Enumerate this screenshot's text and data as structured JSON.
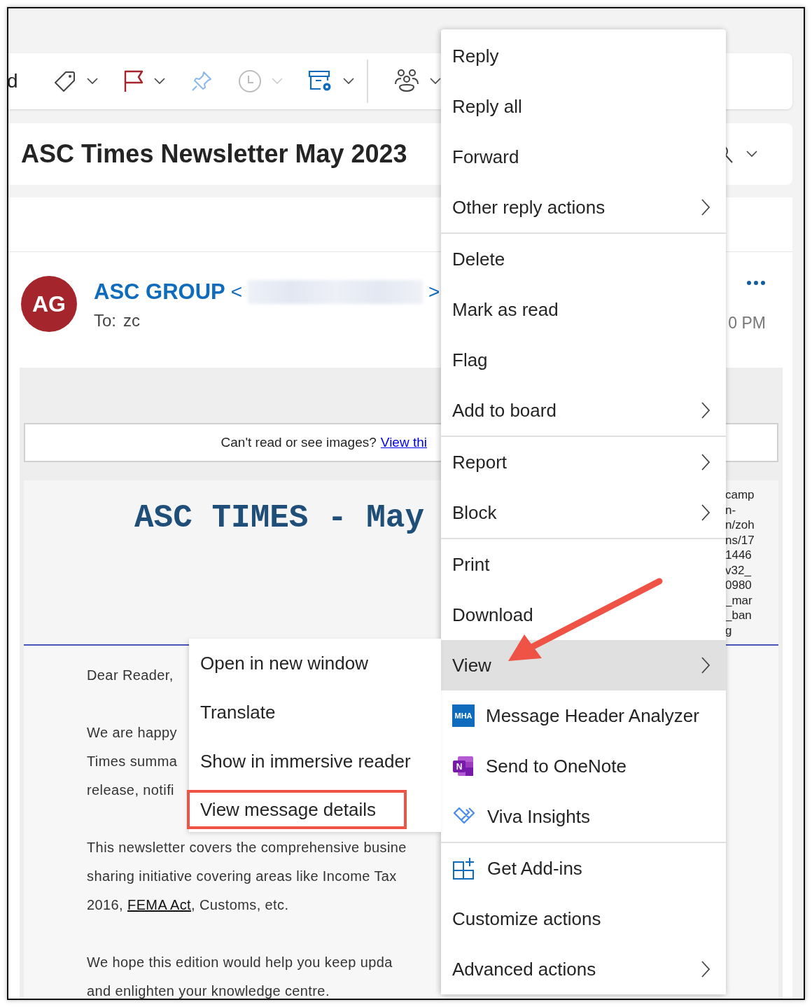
{
  "toolbar": {
    "cut_label": "d",
    "items": [
      {
        "kind": "tag",
        "dropdown": true,
        "disabled": false
      },
      {
        "kind": "flag",
        "dropdown": true,
        "disabled": false
      },
      {
        "kind": "pin",
        "dropdown": false,
        "disabled": false
      },
      {
        "kind": "snooze",
        "dropdown": true,
        "disabled": true
      },
      {
        "kind": "rules",
        "dropdown": true,
        "disabled": false
      },
      {
        "kind": "divider"
      },
      {
        "kind": "groups",
        "dropdown": true,
        "disabled": false
      }
    ]
  },
  "subject": "ASC Times Newsletter May 2023",
  "message": {
    "avatar_initials": "AG",
    "sender": "ASC GROUP",
    "open_bracket": "<",
    "close_bracket": ">",
    "to_label": "To:",
    "to": "zc",
    "time": "0 PM"
  },
  "body": {
    "notice": "Can't read or see images?",
    "notice_link": "View thi",
    "banner_title": "ASC TIMES - May",
    "banner_alt_lines": [
      "camp",
      "n-",
      "n/zoh",
      "ns/17",
      "1446",
      "v32_",
      "0980",
      "_mar",
      "_ban",
      "g"
    ],
    "paragraphs": [
      [
        {
          "text": "Dear Reader,"
        }
      ],
      [
        {
          "text": "We are happy"
        },
        {
          "text": "Times summa"
        },
        {
          "text": "release, notifi"
        }
      ],
      [
        {
          "text": "This newsletter covers the comprehensive busine"
        },
        {
          "text": "sharing initiative covering areas like Income Tax"
        },
        {
          "text": "2016, ",
          "link": "FEMA Act",
          "after": ", Customs, etc."
        }
      ],
      [
        {
          "text": "We hope this edition would help you keep upda"
        },
        {
          "text": "and enlighten your knowledge centre."
        }
      ]
    ]
  },
  "context_menu": {
    "groups": [
      [
        {
          "label": "Reply",
          "kind": "action",
          "selected": false
        },
        {
          "label": "Reply all",
          "kind": "action",
          "selected": false
        },
        {
          "label": "Forward",
          "kind": "action",
          "selected": false
        },
        {
          "label": "Other reply actions",
          "kind": "submenu",
          "selected": false
        }
      ],
      [
        {
          "label": "Delete",
          "kind": "action",
          "selected": false
        },
        {
          "label": "Mark as read",
          "kind": "action",
          "selected": false
        },
        {
          "label": "Flag",
          "kind": "action",
          "selected": false
        },
        {
          "label": "Add to board",
          "kind": "submenu",
          "selected": false
        }
      ],
      [
        {
          "label": "Report",
          "kind": "submenu",
          "selected": false
        },
        {
          "label": "Block",
          "kind": "submenu",
          "selected": false
        }
      ],
      [
        {
          "label": "Print",
          "kind": "action",
          "selected": false
        },
        {
          "label": "Download",
          "kind": "action",
          "selected": false
        },
        {
          "label": "View",
          "kind": "submenu",
          "selected": true
        },
        {
          "label": "Message Header Analyzer",
          "kind": "analyzer",
          "badge": "MHA",
          "selected": false
        },
        {
          "label": "Send to OneNote",
          "kind": "notebook",
          "badge": "N",
          "selected": false
        },
        {
          "label": "Viva Insights",
          "kind": "insights",
          "selected": false
        }
      ],
      [
        {
          "label": "Get Add-ins",
          "kind": "addins",
          "selected": false
        },
        {
          "label": "Customize actions",
          "kind": "action",
          "selected": false
        },
        {
          "label": "Advanced actions",
          "kind": "submenu",
          "selected": false
        }
      ]
    ]
  },
  "view_submenu": {
    "items": [
      {
        "label": "Open in new window",
        "outlined": false
      },
      {
        "label": "Translate",
        "outlined": false
      },
      {
        "label": "Show in immersive reader",
        "outlined": false
      },
      {
        "label": "View message details",
        "outlined": true
      }
    ]
  }
}
